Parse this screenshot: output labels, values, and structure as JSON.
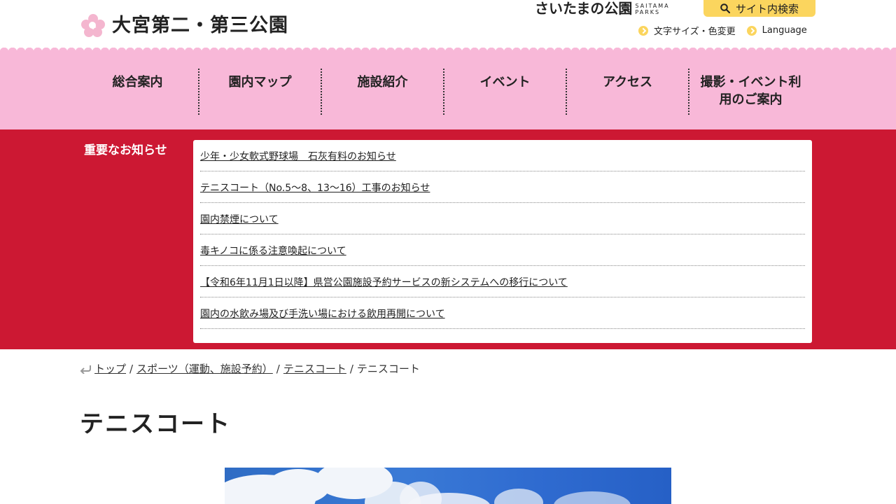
{
  "header": {
    "site_title": "大宮第二・第三公園",
    "brand_jp": "さいたまの公園",
    "brand_en": "SAITAMA PARKS",
    "search_label": "サイト内検索",
    "util_links": [
      "文字サイズ・色変更",
      "Language"
    ]
  },
  "nav": {
    "items": [
      {
        "label": "総合案内"
      },
      {
        "label": "園内マップ"
      },
      {
        "label": "施設紹介"
      },
      {
        "label": "イベント"
      },
      {
        "label": "アクセス"
      },
      {
        "label": "撮影・イベント利用のご案内"
      }
    ]
  },
  "notice": {
    "heading": "重要なお知らせ",
    "items": [
      "少年・少女軟式野球場　石灰有料のお知らせ",
      "テニスコート（No.5～8、13～16）工事のお知らせ",
      "園内禁煙について",
      "毒キノコに係る注意喚起について",
      "【令和6年11月1日以降】県営公園施設予約サービスの新システムへの移行について",
      "園内の水飲み場及び手洗い場における飲用再開について"
    ]
  },
  "breadcrumb": {
    "items": [
      "トップ",
      "スポーツ（運動、施設予約）",
      "テニスコート"
    ],
    "current": "テニスコート"
  },
  "page": {
    "title": "テニスコート"
  },
  "colors": {
    "nav_bg": "#f8b8d8",
    "notice_bg": "#cc1833",
    "accent_yellow": "#fbd55e"
  }
}
